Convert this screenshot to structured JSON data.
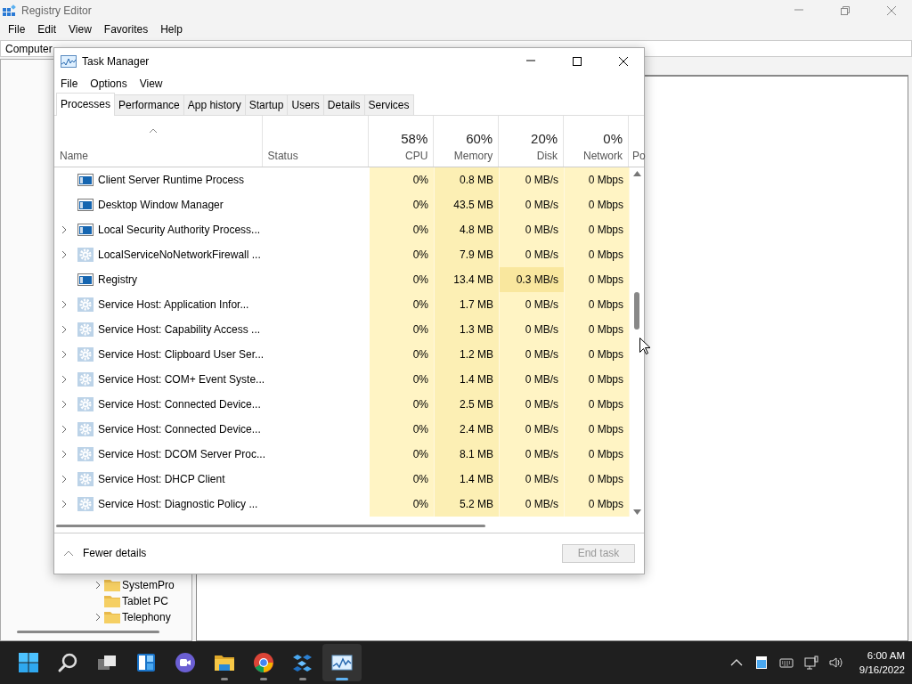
{
  "registry_editor": {
    "title": "Registry Editor",
    "menu": [
      "File",
      "Edit",
      "View",
      "Favorites",
      "Help"
    ],
    "address": "Computer",
    "tree_items": [
      {
        "label": "SystemPro",
        "expandable": true
      },
      {
        "label": "Tablet PC",
        "expandable": false
      },
      {
        "label": "Telephony",
        "expandable": true
      }
    ]
  },
  "task_manager": {
    "title": "Task Manager",
    "menu": [
      "File",
      "Options",
      "View"
    ],
    "tabs": [
      {
        "label": "Processes",
        "selected": true
      },
      {
        "label": "Performance",
        "selected": false
      },
      {
        "label": "App history",
        "selected": false
      },
      {
        "label": "Startup",
        "selected": false
      },
      {
        "label": "Users",
        "selected": false
      },
      {
        "label": "Details",
        "selected": false
      },
      {
        "label": "Services",
        "selected": false
      }
    ],
    "columns": [
      {
        "label": "Name",
        "kind": "name"
      },
      {
        "label": "Status",
        "kind": "status"
      },
      {
        "label": "CPU",
        "percent": "58%",
        "kind": "metric",
        "color": "#fff4c4"
      },
      {
        "label": "Memory",
        "percent": "60%",
        "kind": "metric",
        "color": "#fcefb4"
      },
      {
        "label": "Disk",
        "percent": "20%",
        "kind": "metric",
        "color": "#fff4c4"
      },
      {
        "label": "Network",
        "percent": "0%",
        "kind": "metric",
        "color": "#fff4c4"
      },
      {
        "label": "Po",
        "kind": "cut"
      }
    ],
    "rows": [
      {
        "name": "Client Server Runtime Process",
        "kind": "app",
        "expandable": false,
        "disk_busy": false,
        "values": [
          "0%",
          "0.8 MB",
          "0 MB/s",
          "0 Mbps"
        ]
      },
      {
        "name": "Desktop Window Manager",
        "kind": "app",
        "expandable": false,
        "disk_busy": false,
        "values": [
          "0%",
          "43.5 MB",
          "0 MB/s",
          "0 Mbps"
        ]
      },
      {
        "name": "Local Security Authority Process...",
        "kind": "app",
        "expandable": true,
        "disk_busy": false,
        "values": [
          "0%",
          "4.8 MB",
          "0 MB/s",
          "0 Mbps"
        ]
      },
      {
        "name": "LocalServiceNoNetworkFirewall ...",
        "kind": "service",
        "expandable": true,
        "disk_busy": false,
        "values": [
          "0%",
          "7.9 MB",
          "0 MB/s",
          "0 Mbps"
        ]
      },
      {
        "name": "Registry",
        "kind": "app",
        "expandable": false,
        "disk_busy": true,
        "values": [
          "0%",
          "13.4 MB",
          "0.3 MB/s",
          "0 Mbps"
        ]
      },
      {
        "name": "Service Host: Application Infor...",
        "kind": "service",
        "expandable": true,
        "disk_busy": false,
        "values": [
          "0%",
          "1.7 MB",
          "0 MB/s",
          "0 Mbps"
        ]
      },
      {
        "name": "Service Host: Capability Access ...",
        "kind": "service",
        "expandable": true,
        "disk_busy": false,
        "values": [
          "0%",
          "1.3 MB",
          "0 MB/s",
          "0 Mbps"
        ]
      },
      {
        "name": "Service Host: Clipboard User Ser...",
        "kind": "service",
        "expandable": true,
        "disk_busy": false,
        "values": [
          "0%",
          "1.2 MB",
          "0 MB/s",
          "0 Mbps"
        ]
      },
      {
        "name": "Service Host: COM+ Event Syste...",
        "kind": "service",
        "expandable": true,
        "disk_busy": false,
        "values": [
          "0%",
          "1.4 MB",
          "0 MB/s",
          "0 Mbps"
        ]
      },
      {
        "name": "Service Host: Connected Device...",
        "kind": "service",
        "expandable": true,
        "disk_busy": false,
        "values": [
          "0%",
          "2.5 MB",
          "0 MB/s",
          "0 Mbps"
        ]
      },
      {
        "name": "Service Host: Connected Device...",
        "kind": "service",
        "expandable": true,
        "disk_busy": false,
        "values": [
          "0%",
          "2.4 MB",
          "0 MB/s",
          "0 Mbps"
        ]
      },
      {
        "name": "Service Host: DCOM Server Proc...",
        "kind": "service",
        "expandable": true,
        "disk_busy": false,
        "values": [
          "0%",
          "8.1 MB",
          "0 MB/s",
          "0 Mbps"
        ]
      },
      {
        "name": "Service Host: DHCP Client",
        "kind": "service",
        "expandable": true,
        "disk_busy": false,
        "values": [
          "0%",
          "1.4 MB",
          "0 MB/s",
          "0 Mbps"
        ]
      },
      {
        "name": "Service Host: Diagnostic Policy ...",
        "kind": "service",
        "expandable": true,
        "disk_busy": false,
        "values": [
          "0%",
          "5.2 MB",
          "0 MB/s",
          "0 Mbps"
        ]
      }
    ],
    "fewer_details": "Fewer details",
    "end_task": {
      "label": "End task",
      "disabled": true
    }
  },
  "taskbar": {
    "apps": [
      {
        "kind": "start",
        "active": false
      },
      {
        "kind": "search",
        "active": false
      },
      {
        "kind": "taskview",
        "active": false
      },
      {
        "kind": "widgets",
        "active": false
      },
      {
        "kind": "chat",
        "active": false
      },
      {
        "kind": "explorer",
        "active": false
      },
      {
        "kind": "browser",
        "active": false
      },
      {
        "kind": "registry",
        "active": false
      },
      {
        "kind": "taskmanager",
        "active": true
      }
    ],
    "time": "6:00 AM",
    "date": "9/16/2022"
  }
}
